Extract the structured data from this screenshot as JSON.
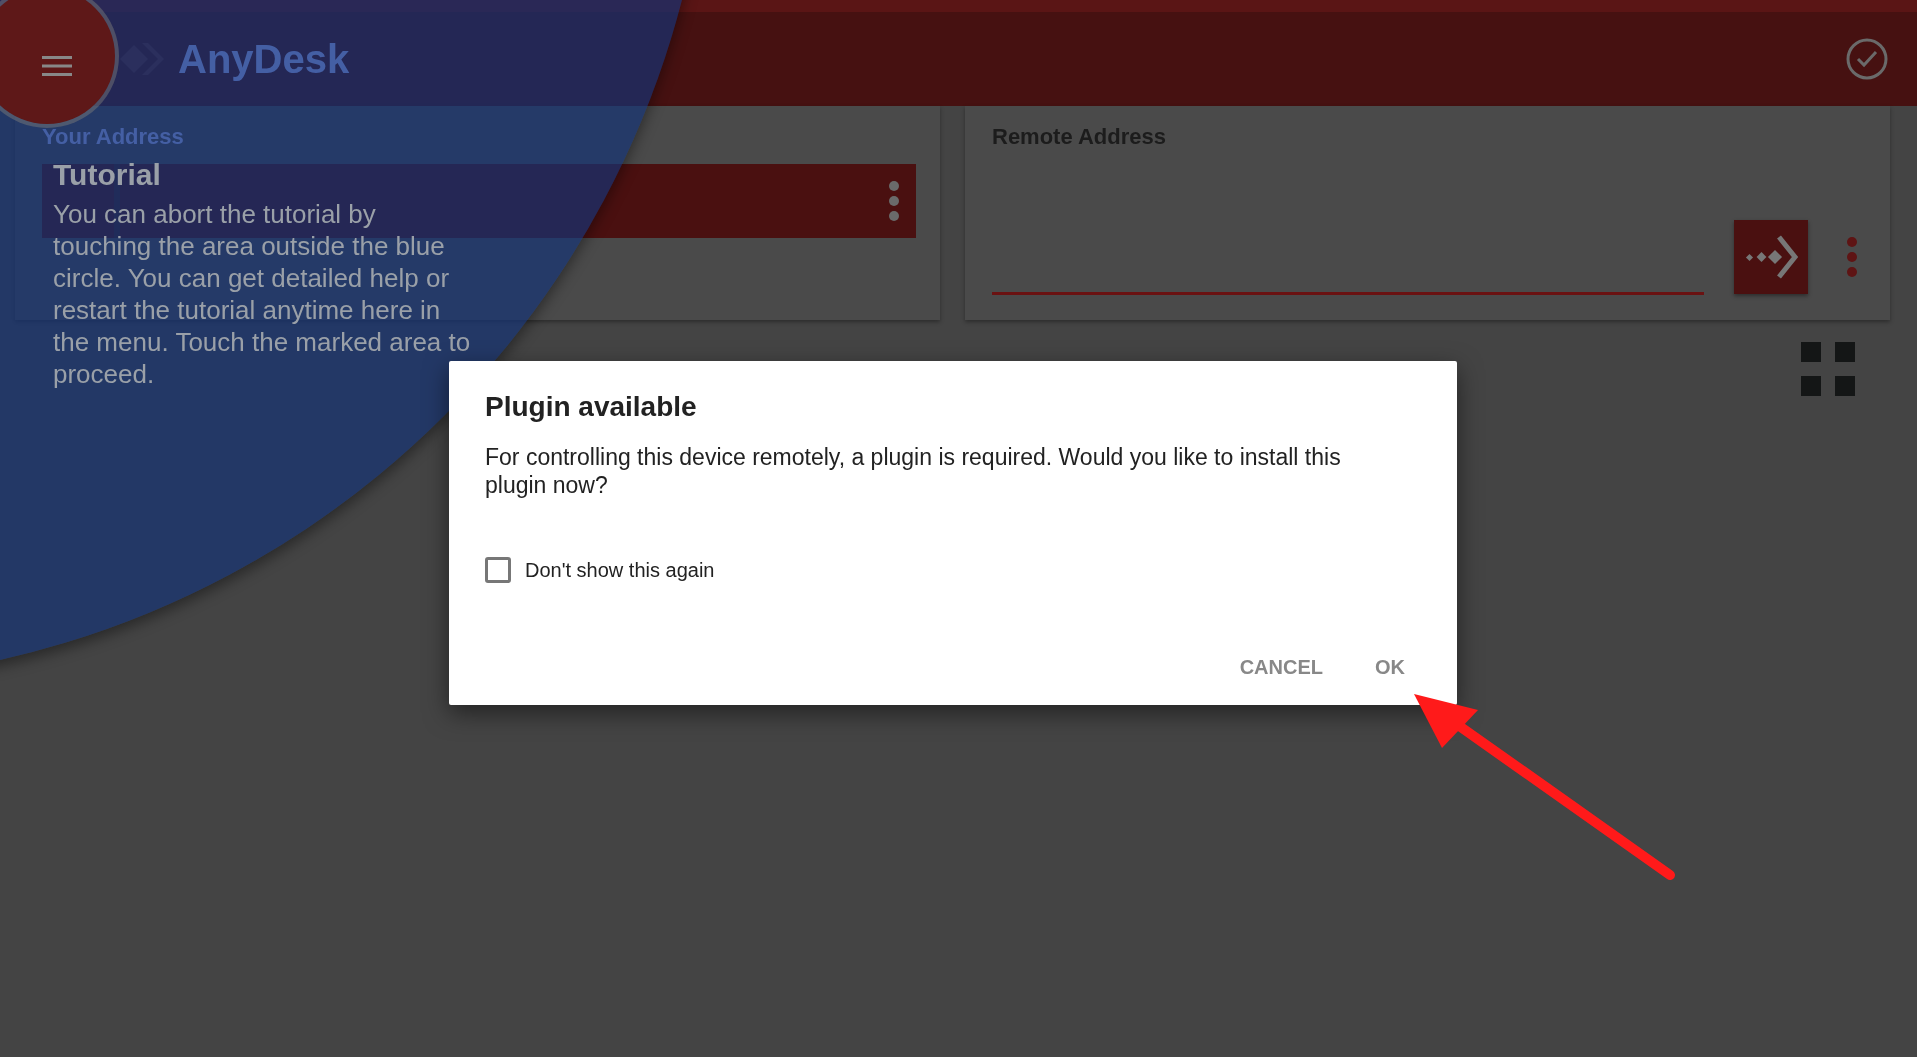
{
  "app_bar": {
    "logo": "AnyDesk"
  },
  "your_address": {
    "label": "Your Address"
  },
  "remote_address": {
    "label": "Remote Address"
  },
  "tutorial": {
    "title": "Tutorial",
    "text": "You can abort the tutorial by touching the area outside the blue circle. You can get detailed help or restart the tutorial anytime here in the menu. Touch the marked area to proceed."
  },
  "dialog": {
    "title": "Plugin available",
    "message": "For controlling this device remotely, a plugin is required. Would you like to install this plugin now?",
    "checkbox": {
      "label": "Don't show this again",
      "checked": false
    },
    "buttons": [
      "CANCEL",
      "OK"
    ]
  }
}
